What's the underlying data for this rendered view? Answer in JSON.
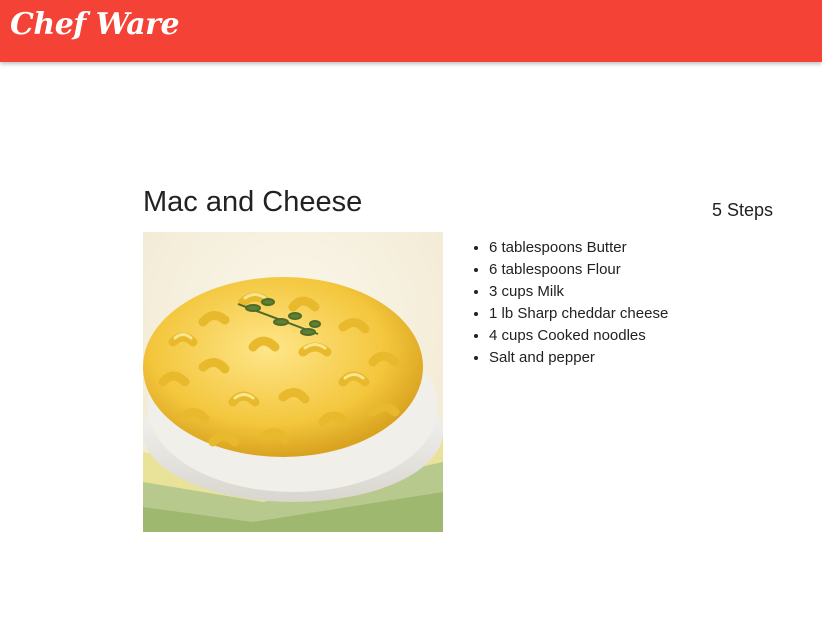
{
  "header": {
    "brand": "Chef Ware",
    "color": "#f44336"
  },
  "recipe": {
    "title": "Mac and Cheese",
    "steps_label": "5 Steps",
    "image": "mac-and-cheese-photo",
    "ingredients": [
      "6 tablespoons Butter",
      "6 tablespoons Flour",
      "3 cups Milk",
      "1 lb Sharp cheddar cheese",
      "4 cups Cooked noodles",
      "Salt and pepper"
    ]
  }
}
